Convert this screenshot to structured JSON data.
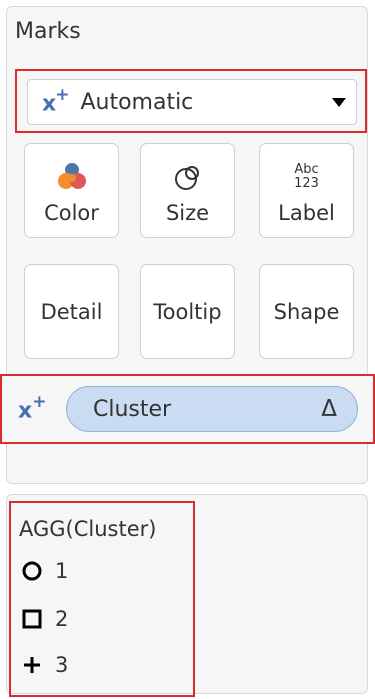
{
  "marks": {
    "title": "Marks",
    "mark_type": {
      "prefix_icon": "x-plus-icon",
      "label": "Automatic"
    },
    "properties": [
      {
        "id": "color",
        "label": "Color",
        "icon": "color-palette-icon"
      },
      {
        "id": "size",
        "label": "Size",
        "icon": "size-circles-icon"
      },
      {
        "id": "label",
        "label": "Label",
        "icon": "abc-123-text-icon",
        "icon_text_top": "Abc",
        "icon_text_bottom": "123"
      },
      {
        "id": "detail",
        "label": "Detail"
      },
      {
        "id": "tooltip",
        "label": "Tooltip"
      },
      {
        "id": "shape",
        "label": "Shape"
      }
    ],
    "detail_pill": {
      "prefix_icon": "x-plus-icon",
      "field": "Cluster",
      "delta": "Δ"
    }
  },
  "legend": {
    "title": "AGG(Cluster)",
    "items": [
      {
        "shape": "circle",
        "label": "1"
      },
      {
        "shape": "square",
        "label": "2"
      },
      {
        "shape": "plus",
        "label": "3"
      }
    ]
  },
  "colors": {
    "highlight": "#d92d2d",
    "pill_bg": "#c9dcf2",
    "pill_border": "#8fb2dc",
    "icon_blue": "#4a6fb0"
  }
}
